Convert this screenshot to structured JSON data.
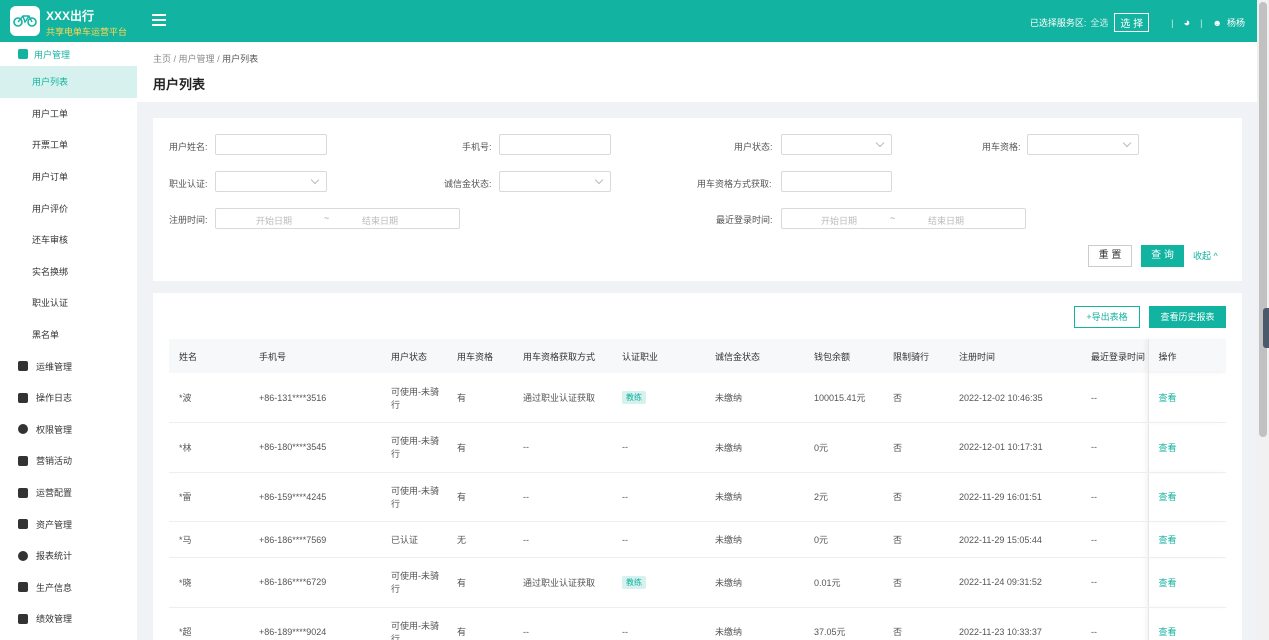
{
  "header": {
    "brand": "XXX出行",
    "brand_sub": "共享电单车运营平台",
    "selected_area_label": "已选择服务区:",
    "selected_area_value": "全选",
    "select_button": "选 择",
    "user_name": "杨杨",
    "colors": {
      "primary": "#12b3a0",
      "brand_sub": "#ffd84d"
    }
  },
  "sidebar": {
    "group": "用户管理",
    "items": [
      "用户列表",
      "用户工单",
      "开票工单",
      "用户订单",
      "用户评价",
      "还车审核",
      "实名换绑",
      "职业认证",
      "黑名单"
    ],
    "main": [
      "运维管理",
      "操作日志",
      "权限管理",
      "营销活动",
      "运营配置",
      "资产管理",
      "报表统计",
      "生产信息",
      "绩效管理"
    ]
  },
  "breadcrumb": {
    "home": "主页",
    "parent": "用户管理",
    "current": "用户列表"
  },
  "page_title": "用户列表",
  "filter": {
    "user_name": "用户姓名:",
    "phone": "手机号:",
    "user_status": "用户状态:",
    "car_qual": "用车资格:",
    "occupation": "职业认证:",
    "deposit_status": "诚信金状态:",
    "qual_method": "用车资格方式获取:",
    "reg_time": "注册时间:",
    "last_login": "最近登录时间:",
    "start_date": "开始日期",
    "end_date": "结束日期",
    "tilde": "~",
    "reset": "重 置",
    "query": "查 询",
    "collapse": "收起 ^"
  },
  "table": {
    "export_button": "+导出表格",
    "history_button": "查看历史报表",
    "columns": [
      "姓名",
      "手机号",
      "用户状态",
      "用车资格",
      "用车资格获取方式",
      "认证职业",
      "诚信金状态",
      "钱包余额",
      "限制骑行",
      "注册时间",
      "最近登录时间",
      "操作"
    ],
    "rows": [
      {
        "name": "*波",
        "phone": "+86-131****3516",
        "status": "可使用-未骑行",
        "qual": "有",
        "method": "通过职业认证获取",
        "job": "教练",
        "deposit": "未缴纳",
        "balance": "100015.41元",
        "limit": "否",
        "reg": "2022-12-02 10:46:35",
        "login": "--",
        "op": "查看"
      },
      {
        "name": "*林",
        "phone": "+86-180****3545",
        "status": "可使用-未骑行",
        "qual": "有",
        "method": "--",
        "job": "--",
        "deposit": "未缴纳",
        "balance": "0元",
        "limit": "否",
        "reg": "2022-12-01 10:17:31",
        "login": "--",
        "op": "查看"
      },
      {
        "name": "*雷",
        "phone": "+86-159****4245",
        "status": "可使用-未骑行",
        "qual": "有",
        "method": "--",
        "job": "--",
        "deposit": "未缴纳",
        "balance": "2元",
        "limit": "否",
        "reg": "2022-11-29 16:01:51",
        "login": "--",
        "op": "查看"
      },
      {
        "name": "*马",
        "phone": "+86-186****7569",
        "status": "已认证",
        "qual": "无",
        "method": "--",
        "job": "--",
        "deposit": "未缴纳",
        "balance": "0元",
        "limit": "否",
        "reg": "2022-11-29 15:05:44",
        "login": "--",
        "op": "查看"
      },
      {
        "name": "*晓",
        "phone": "+86-186****6729",
        "status": "可使用-未骑行",
        "qual": "有",
        "method": "通过职业认证获取",
        "job": "教练",
        "deposit": "未缴纳",
        "balance": "0.01元",
        "limit": "否",
        "reg": "2022-11-24 09:31:52",
        "login": "--",
        "op": "查看"
      },
      {
        "name": "*超",
        "phone": "+86-189****9024",
        "status": "可使用-未骑行",
        "qual": "有",
        "method": "--",
        "job": "--",
        "deposit": "未缴纳",
        "balance": "37.05元",
        "limit": "否",
        "reg": "2022-11-23 10:33:37",
        "login": "--",
        "op": "查看"
      }
    ]
  }
}
